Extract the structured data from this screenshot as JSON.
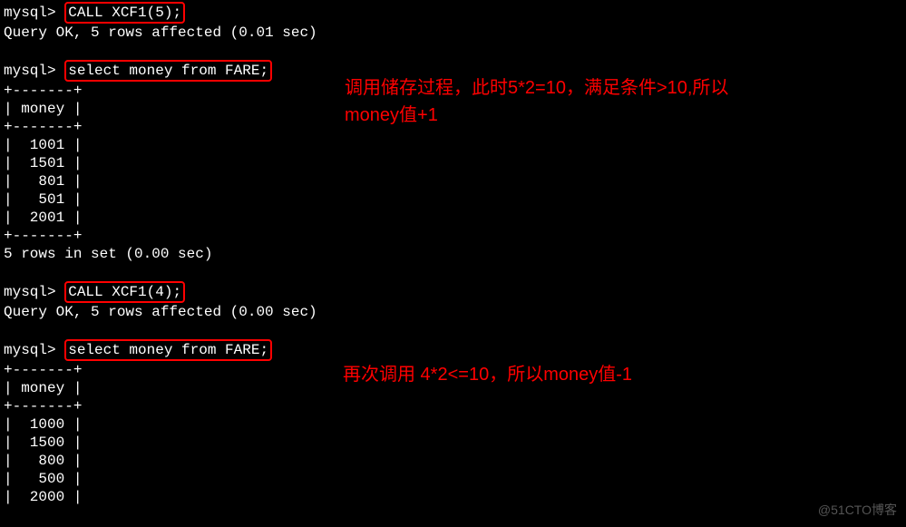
{
  "prompt": "mysql>",
  "cmd1": "CALL XCF1(5);",
  "result1": "Query OK, 5 rows affected (0.01 sec)",
  "cmd2": "select money from FARE;",
  "table1": {
    "divider": "+-------+",
    "header": "| money |",
    "rows": [
      "|  1001 |",
      "|  1501 |",
      "|   801 |",
      "|   501 |",
      "|  2001 |"
    ],
    "footer": "5 rows in set (0.00 sec)"
  },
  "cmd3": "CALL XCF1(4);",
  "result3": "Query OK, 5 rows affected (0.00 sec)",
  "cmd4": "select money from FARE;",
  "table2": {
    "divider": "+-------+",
    "header": "| money |",
    "rows": [
      "|  1000 |",
      "|  1500 |",
      "|   800 |",
      "|   500 |",
      "|  2000 |"
    ]
  },
  "annotation1_line1": "调用储存过程，此时5*2=10，满足条件>10,所以",
  "annotation1_line2": "money值+1",
  "annotation2": "再次调用 4*2<=10，所以money值-1",
  "watermark": "@51CTO博客"
}
